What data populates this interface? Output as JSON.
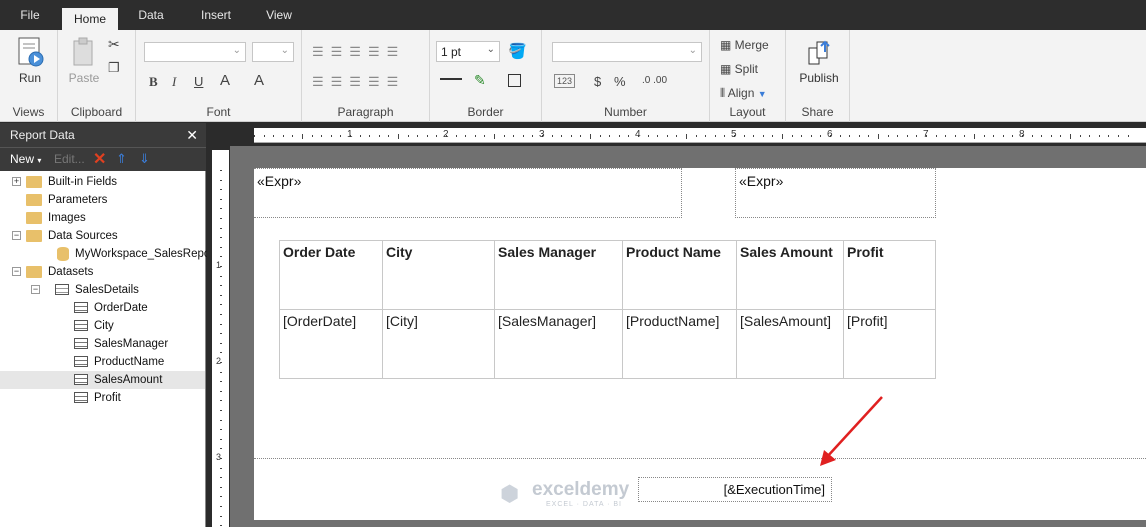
{
  "menu": {
    "tabs": [
      "File",
      "Home",
      "Data",
      "Insert",
      "View"
    ],
    "active": "Home"
  },
  "ribbon": {
    "views": {
      "run_label": "Run",
      "group_label": "Views"
    },
    "clipboard": {
      "paste_label": "Paste",
      "group_label": "Clipboard"
    },
    "font": {
      "group_label": "Font",
      "bold": "B",
      "italic": "I",
      "underline": "U",
      "color": "A",
      "grow": "A"
    },
    "paragraph": {
      "group_label": "Paragraph"
    },
    "border": {
      "group_label": "Border",
      "width_value": "1 pt"
    },
    "number": {
      "group_label": "Number",
      "placeholder_icon": "123",
      "currency": "$",
      "percent": "%"
    },
    "layout": {
      "group_label": "Layout",
      "merge": "Merge",
      "split": "Split",
      "align": "Align"
    },
    "share": {
      "group_label": "Share",
      "publish": "Publish"
    }
  },
  "report_data": {
    "title": "Report Data",
    "toolbar": {
      "new": "New",
      "edit": "Edit..."
    },
    "tree": [
      {
        "label": "Built-in Fields",
        "level": 0,
        "type": "folder",
        "expander": "+"
      },
      {
        "label": "Parameters",
        "level": 0,
        "type": "folder",
        "expander": ""
      },
      {
        "label": "Images",
        "level": 0,
        "type": "folder",
        "expander": ""
      },
      {
        "label": "Data Sources",
        "level": 0,
        "type": "folder",
        "expander": "−"
      },
      {
        "label": "MyWorkspace_SalesReport",
        "level": 1,
        "type": "datasource",
        "expander": ""
      },
      {
        "label": "Datasets",
        "level": 0,
        "type": "folder",
        "expander": "−"
      },
      {
        "label": "SalesDetails",
        "level": 1,
        "type": "dataset",
        "expander": "−"
      },
      {
        "label": "OrderDate",
        "level": 2,
        "type": "field",
        "expander": ""
      },
      {
        "label": "City",
        "level": 2,
        "type": "field",
        "expander": ""
      },
      {
        "label": "SalesManager",
        "level": 2,
        "type": "field",
        "expander": ""
      },
      {
        "label": "ProductName",
        "level": 2,
        "type": "field",
        "expander": ""
      },
      {
        "label": "SalesAmount",
        "level": 2,
        "type": "field",
        "expander": "",
        "selected": true
      },
      {
        "label": "Profit",
        "level": 2,
        "type": "field",
        "expander": ""
      }
    ]
  },
  "ruler": {
    "marks": [
      "1",
      "2",
      "3",
      "4",
      "5",
      "6",
      "7",
      "8"
    ],
    "left_marks": [
      "1",
      "2",
      "3"
    ]
  },
  "report": {
    "expr1": "«Expr»",
    "expr2": "«Expr»",
    "headers": [
      "Order Date",
      "City",
      "Sales Manager",
      "Product Name",
      "Sales Amount",
      "Profit"
    ],
    "fields": [
      "[OrderDate]",
      "[City]",
      "[SalesManager]",
      "[ProductName]",
      "[SalesAmount]",
      "[Profit]"
    ],
    "footer_expr": "[&ExecutionTime]"
  },
  "watermark": {
    "name": "exceldemy",
    "tagline": "EXCEL · DATA · BI"
  },
  "colors": {
    "accent_arrow": "#e02020",
    "folder": "#e8c06a",
    "delete_x": "#e04020",
    "arrow_blue": "#3b7dd8"
  }
}
